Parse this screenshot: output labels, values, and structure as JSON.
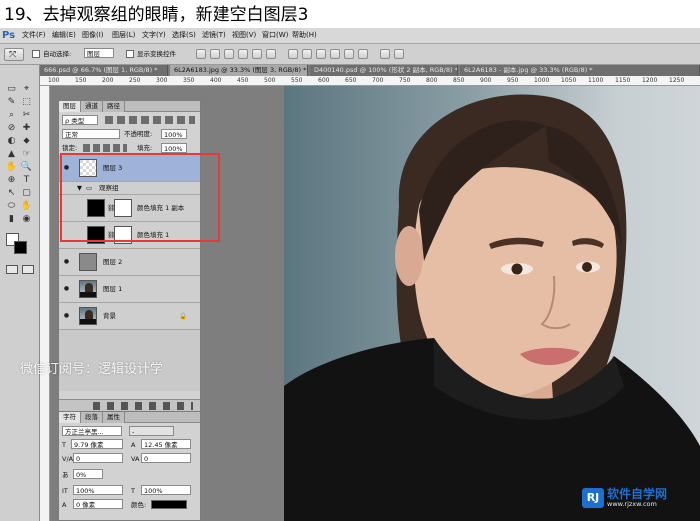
{
  "caption": "19、去掉观察组的眼睛，新建空白图层3",
  "app": {
    "logo": "Ps",
    "menu": [
      "文件(F)",
      "编辑(E)",
      "图像(I)",
      "图层(L)",
      "文字(Y)",
      "选择(S)",
      "滤镜(T)",
      "视图(V)",
      "窗口(W)",
      "帮助(H)"
    ]
  },
  "options_bar": {
    "auto_select_label": "自动选择:",
    "auto_select_value": "图层",
    "show_transform_label": "显示变换控件"
  },
  "doc_tabs": [
    {
      "label": "666.psd @ 66.7% (图层 1, RGB/8) *",
      "active": false
    },
    {
      "label": "6L2A6183.jpg @ 33.3% (图层 3, RGB/8) *",
      "active": true
    },
    {
      "label": "D400140.psd @ 100% (形状 2 副本, RGB/8) *",
      "active": false
    },
    {
      "label": "6L2A6183 - 副本.jpg @ 33.3% (RGB/8) *",
      "active": false
    }
  ],
  "ruler_marks": [
    "100",
    "150",
    "200",
    "250",
    "300",
    "350",
    "400",
    "450",
    "500",
    "550",
    "600",
    "650",
    "700",
    "750",
    "800",
    "850",
    "900",
    "950",
    "1000",
    "1050",
    "1100",
    "1150",
    "1200",
    "1250"
  ],
  "layers_panel": {
    "tabs": [
      "图层",
      "通道",
      "路径"
    ],
    "filter_label": "ρ 类型",
    "blend_mode": "正常",
    "opacity_label": "不透明度:",
    "opacity_value": "100%",
    "lock_label": "锁定:",
    "fill_label": "填充:",
    "fill_value": "100%",
    "layers": [
      {
        "name": "图层 3",
        "kind": "transparent",
        "visible": true,
        "selected": true,
        "indent": 0,
        "lock": ""
      },
      {
        "name": "观察组",
        "kind": "group",
        "visible": false,
        "selected": false,
        "indent": 0,
        "lock": ""
      },
      {
        "name": "颜色填充 1 副本",
        "kind": "fill",
        "visible": false,
        "selected": false,
        "indent": 1,
        "lock": ""
      },
      {
        "name": "颜色填充 1",
        "kind": "fill",
        "visible": false,
        "selected": false,
        "indent": 1,
        "lock": ""
      },
      {
        "name": "图层 2",
        "kind": "photo-gray",
        "visible": true,
        "selected": false,
        "indent": 0,
        "lock": ""
      },
      {
        "name": "图层 1",
        "kind": "photo",
        "visible": true,
        "selected": false,
        "indent": 0,
        "lock": ""
      },
      {
        "name": "背景",
        "kind": "photo",
        "visible": true,
        "selected": false,
        "indent": 0,
        "lock": "🔒"
      }
    ]
  },
  "character_panel": {
    "tabs": [
      "字符",
      "段落",
      "属性"
    ],
    "font_family": "方正兰亭黑...",
    "font_style": "-",
    "font_size": "9.79 像素",
    "leading": "12.45 像素",
    "kerning": "0",
    "tracking": "0",
    "tsume": "0%",
    "vscale": "100%",
    "hscale": "100%",
    "baseline": "0 像素"
  },
  "watermark": "微信订阅号：逻辑设计学",
  "site_logo": {
    "brand": "软件自学网",
    "url": "www.rjzxw.com",
    "badge": "RJ"
  },
  "colors": {
    "selected_layer": "#9fb3d8",
    "highlight_frame": "#e53a3a",
    "accent": "#2b65b8"
  }
}
